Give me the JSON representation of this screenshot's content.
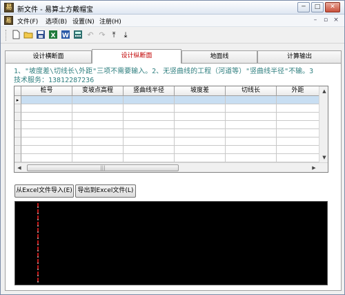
{
  "window": {
    "title": "新文件 - 易算土方戴帽宝",
    "app_icon_glyph": "易",
    "minimize_glyph": "─",
    "maximize_glyph": "□",
    "close_glyph": "✕"
  },
  "menubar": {
    "items": [
      "文件(F)",
      "选项(B)",
      "设置(N)",
      "注册(H)"
    ],
    "mdi_controls": [
      "–",
      "▫",
      "×"
    ]
  },
  "toolbar": {
    "icons": [
      {
        "name": "new-document-icon",
        "glyph": "🗋"
      },
      {
        "name": "open-folder-icon",
        "glyph": "📂"
      },
      {
        "name": "save-icon",
        "glyph": "💾"
      },
      {
        "name": "excel-icon",
        "glyph": "X"
      },
      {
        "name": "word-icon",
        "glyph": "W"
      },
      {
        "name": "calculator-icon",
        "glyph": "▦"
      },
      {
        "name": "undo-icon",
        "glyph": "↶"
      },
      {
        "name": "redo-icon",
        "glyph": "↷"
      },
      {
        "name": "move-top-icon",
        "glyph": "⤒"
      },
      {
        "name": "move-bottom-icon",
        "glyph": "⤓"
      }
    ]
  },
  "tabs": [
    {
      "label": "设计横断面",
      "active": false
    },
    {
      "label": "设计纵断面",
      "active": true
    },
    {
      "label": "地面线",
      "active": false
    },
    {
      "label": "计算输出",
      "active": false
    }
  ],
  "hint": {
    "line1": "1、\"坡度差\\切线长\\外距\"三项不需要输入。2、无竖曲线的工程（河道等）\"竖曲线半径\"不输。3",
    "line2": "   技术服务：13812287236"
  },
  "grid": {
    "columns": [
      "桩号",
      "变坡点高程",
      "竖曲线半径",
      "坡度差",
      "切线长",
      "外距"
    ],
    "row_count": 9,
    "current_row_marker": "▸"
  },
  "scroll": {
    "up": "▲",
    "down": "▼",
    "left": "◀",
    "right": "▶",
    "thumb_grip": "|||"
  },
  "buttons": {
    "import_excel": "从Excel文件导入(E)",
    "export_excel": "导出到Excel文件(L)"
  },
  "colors": {
    "hint_text": "#2f7f7f",
    "active_tab_text": "#c00000",
    "selected_cell": "#c8def2",
    "canvas_bg": "#000000",
    "dashed_line": "#ff2020"
  }
}
